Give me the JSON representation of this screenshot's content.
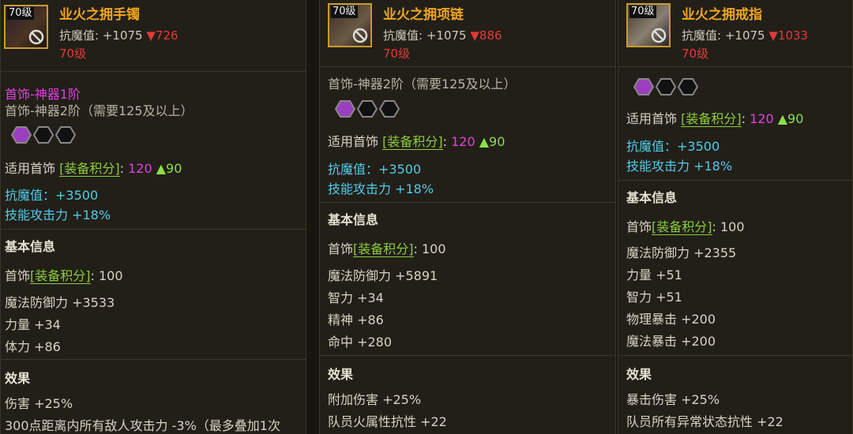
{
  "items": [
    {
      "level_badge": "70级",
      "name": "业火之拥手镯",
      "resist_label": "抗魔值",
      "resist_value": "+1075",
      "resist_change": "▼726",
      "level_req": "70级",
      "category_line": "首饰-神器1阶",
      "next_category": "首饰-神器2阶（需要125及以上）",
      "score_prefix": "适用首饰",
      "score_label": "[装备积分]",
      "score_value": "120",
      "score_delta": "▲90",
      "bonus_1": "抗魔值：+3500",
      "bonus_2": "技能攻击力 +18%",
      "basic_header": "基本信息",
      "basic_score_prefix": "首饰",
      "basic_score_label": "[装备积分]",
      "basic_score_value": "100",
      "stats": [
        "魔法防御力 +3533",
        "力量 +34",
        "体力 +86"
      ],
      "effect_header": "效果",
      "effects": [
        "伤害 +25%",
        "300点距离内所有敌人攻击力 -3%（最多叠加1次"
      ]
    },
    {
      "level_badge": "70级",
      "name": "业火之拥项链",
      "resist_label": "抗魔值",
      "resist_value": "+1075",
      "resist_change": "▼886",
      "level_req": "70级",
      "next_category": "首饰-神器2阶（需要125及以上）",
      "score_prefix": "适用首饰",
      "score_label": "[装备积分]",
      "score_value": "120",
      "score_delta": "▲90",
      "bonus_1": "抗魔值：+3500",
      "bonus_2": "技能攻击力 +18%",
      "basic_header": "基本信息",
      "basic_score_prefix": "首饰",
      "basic_score_label": "[装备积分]",
      "basic_score_value": "100",
      "stats": [
        "魔法防御力 +5891",
        "智力 +34",
        "精神 +86",
        "命中 +280"
      ],
      "effect_header": "效果",
      "effects": [
        "附加伤害 +25%",
        "队员火属性抗性 +22"
      ]
    },
    {
      "level_badge": "70级",
      "name": "业火之拥戒指",
      "resist_label": "抗魔值",
      "resist_value": "+1075",
      "resist_change": "▼1033",
      "level_req": "70级",
      "score_prefix": "适用首饰",
      "score_label": "[装备积分]",
      "score_value": "120",
      "score_delta": "▲90",
      "bonus_1": "抗魔值：+3500",
      "bonus_2": "技能攻击力 +18%",
      "basic_header": "基本信息",
      "basic_score_prefix": "首饰",
      "basic_score_label": "[装备积分]",
      "basic_score_value": "100",
      "stats": [
        "魔法防御力 +2355",
        "力量 +51",
        "智力 +51",
        "物理暴击 +200",
        "魔法暴击 +200"
      ],
      "effect_header": "效果",
      "effects": [
        "暴击伤害 +25%",
        "队员所有异常状态抗性 +22"
      ]
    }
  ],
  "colors": {
    "title": "#f0a520",
    "decrease": "#e23a3a",
    "increase": "#8be04a",
    "purple": "#e040e0",
    "cyan": "#52cbe8",
    "bracket": "#8ccc3c"
  },
  "icons": [
    "no-entry-icon",
    "socket-gem-icon",
    "socket-empty-icon"
  ]
}
